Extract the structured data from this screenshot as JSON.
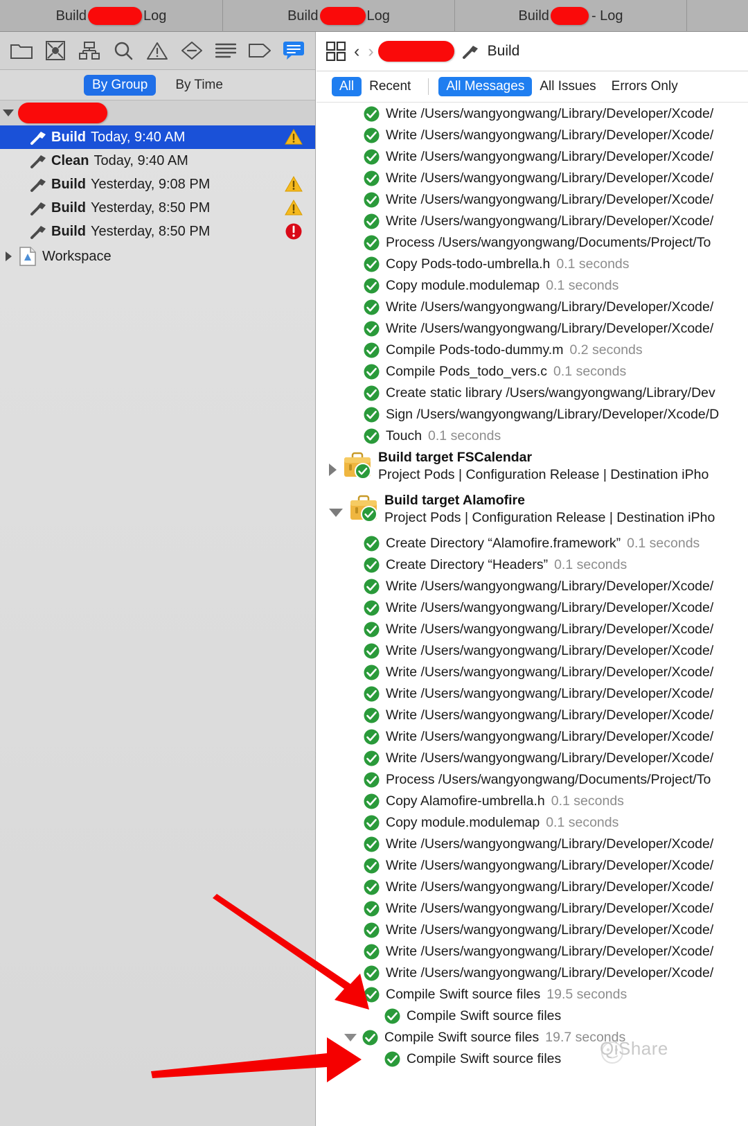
{
  "window": {
    "tabs": [
      {
        "prefix": "Build",
        "suffix": "Log",
        "redacted": true
      },
      {
        "prefix": "Build",
        "suffix": "Log",
        "redacted": true
      },
      {
        "prefix": "Build",
        "suffix": "- Log",
        "redacted": true
      },
      {
        "prefix": "",
        "suffix": "",
        "redacted": false
      }
    ]
  },
  "navigator": {
    "toolbar_icons": [
      "folder-icon",
      "source-control-icon",
      "symbol-hierarchy-icon",
      "search-icon",
      "warning-triangle-icon",
      "breakpoint-icon",
      "report-icon",
      "tag-icon",
      "log-bubble-icon"
    ],
    "scope": {
      "by_group": "By Group",
      "by_time": "By Time",
      "selected": "By Group"
    },
    "group_redacted": true,
    "items": [
      {
        "action": "Build",
        "when": "Today, 9:40 AM",
        "status": "warning",
        "selected": true
      },
      {
        "action": "Clean",
        "when": "Today, 9:40 AM",
        "status": "none",
        "selected": false
      },
      {
        "action": "Build",
        "when": "Yesterday, 9:08 PM",
        "status": "warning",
        "selected": false
      },
      {
        "action": "Build",
        "when": "Yesterday, 8:50 PM",
        "status": "warning",
        "selected": false
      },
      {
        "action": "Build",
        "when": "Yesterday, 8:50 PM",
        "status": "error",
        "selected": false
      }
    ],
    "workspace_label": "Workspace"
  },
  "log": {
    "breadcrumb": {
      "project_redacted": true,
      "action": "Build"
    },
    "filters": {
      "scope": [
        "All",
        "Recent"
      ],
      "scope_selected": "All",
      "level": [
        "All Messages",
        "All Issues",
        "Errors Only"
      ],
      "level_selected": "All Messages"
    },
    "rows": [
      {
        "kind": "task",
        "text": "Write /Users/wangyongwang/Library/Developer/Xcode/",
        "dur": "",
        "indent": 1
      },
      {
        "kind": "task",
        "text": "Write /Users/wangyongwang/Library/Developer/Xcode/",
        "dur": "",
        "indent": 1
      },
      {
        "kind": "task",
        "text": "Write /Users/wangyongwang/Library/Developer/Xcode/",
        "dur": "",
        "indent": 1
      },
      {
        "kind": "task",
        "text": "Write /Users/wangyongwang/Library/Developer/Xcode/",
        "dur": "",
        "indent": 1
      },
      {
        "kind": "task",
        "text": "Write /Users/wangyongwang/Library/Developer/Xcode/",
        "dur": "",
        "indent": 1
      },
      {
        "kind": "task",
        "text": "Write /Users/wangyongwang/Library/Developer/Xcode/",
        "dur": "",
        "indent": 1
      },
      {
        "kind": "task",
        "text": "Process /Users/wangyongwang/Documents/Project/To",
        "dur": "",
        "indent": 1
      },
      {
        "kind": "task",
        "text": "Copy Pods-todo-umbrella.h",
        "dur": "0.1 seconds",
        "indent": 1
      },
      {
        "kind": "task",
        "text": "Copy module.modulemap",
        "dur": "0.1 seconds",
        "indent": 1
      },
      {
        "kind": "task",
        "text": "Write /Users/wangyongwang/Library/Developer/Xcode/",
        "dur": "",
        "indent": 1
      },
      {
        "kind": "task",
        "text": "Write /Users/wangyongwang/Library/Developer/Xcode/",
        "dur": "",
        "indent": 1
      },
      {
        "kind": "task",
        "text": "Compile Pods-todo-dummy.m",
        "dur": "0.2 seconds",
        "indent": 1
      },
      {
        "kind": "task",
        "text": "Compile Pods_todo_vers.c",
        "dur": "0.1 seconds",
        "indent": 1
      },
      {
        "kind": "task",
        "text": "Create static library /Users/wangyongwang/Library/Dev",
        "dur": "",
        "indent": 1
      },
      {
        "kind": "task",
        "text": "Sign /Users/wangyongwang/Library/Developer/Xcode/D",
        "dur": "",
        "indent": 1
      },
      {
        "kind": "task",
        "text": "Touch",
        "dur": "0.1 seconds",
        "indent": 1
      },
      {
        "kind": "target",
        "title": "Build target FSCalendar",
        "sub": "Project Pods | Configuration Release | Destination iPho",
        "expanded": false
      },
      {
        "kind": "target",
        "title": "Build target Alamofire",
        "sub": "Project Pods | Configuration Release | Destination iPho",
        "expanded": true
      },
      {
        "kind": "task",
        "text": "Create Directory “Alamofire.framework”",
        "dur": "0.1 seconds",
        "indent": 1
      },
      {
        "kind": "task",
        "text": "Create Directory “Headers”",
        "dur": "0.1 seconds",
        "indent": 1
      },
      {
        "kind": "task",
        "text": "Write /Users/wangyongwang/Library/Developer/Xcode/",
        "dur": "",
        "indent": 1
      },
      {
        "kind": "task",
        "text": "Write /Users/wangyongwang/Library/Developer/Xcode/",
        "dur": "",
        "indent": 1
      },
      {
        "kind": "task",
        "text": "Write /Users/wangyongwang/Library/Developer/Xcode/",
        "dur": "",
        "indent": 1
      },
      {
        "kind": "task",
        "text": "Write /Users/wangyongwang/Library/Developer/Xcode/",
        "dur": "",
        "indent": 1
      },
      {
        "kind": "task",
        "text": "Write /Users/wangyongwang/Library/Developer/Xcode/",
        "dur": "",
        "indent": 1
      },
      {
        "kind": "task",
        "text": "Write /Users/wangyongwang/Library/Developer/Xcode/",
        "dur": "",
        "indent": 1
      },
      {
        "kind": "task",
        "text": "Write /Users/wangyongwang/Library/Developer/Xcode/",
        "dur": "",
        "indent": 1
      },
      {
        "kind": "task",
        "text": "Write /Users/wangyongwang/Library/Developer/Xcode/",
        "dur": "",
        "indent": 1
      },
      {
        "kind": "task",
        "text": "Write /Users/wangyongwang/Library/Developer/Xcode/",
        "dur": "",
        "indent": 1
      },
      {
        "kind": "task",
        "text": "Process /Users/wangyongwang/Documents/Project/To",
        "dur": "",
        "indent": 1
      },
      {
        "kind": "task",
        "text": "Copy Alamofire-umbrella.h",
        "dur": "0.1 seconds",
        "indent": 1
      },
      {
        "kind": "task",
        "text": "Copy module.modulemap",
        "dur": "0.1 seconds",
        "indent": 1
      },
      {
        "kind": "task",
        "text": "Write /Users/wangyongwang/Library/Developer/Xcode/",
        "dur": "",
        "indent": 1
      },
      {
        "kind": "task",
        "text": "Write /Users/wangyongwang/Library/Developer/Xcode/",
        "dur": "",
        "indent": 1
      },
      {
        "kind": "task",
        "text": "Write /Users/wangyongwang/Library/Developer/Xcode/",
        "dur": "",
        "indent": 1
      },
      {
        "kind": "task",
        "text": "Write /Users/wangyongwang/Library/Developer/Xcode/",
        "dur": "",
        "indent": 1
      },
      {
        "kind": "task",
        "text": "Write /Users/wangyongwang/Library/Developer/Xcode/",
        "dur": "",
        "indent": 1
      },
      {
        "kind": "task",
        "text": "Write /Users/wangyongwang/Library/Developer/Xcode/",
        "dur": "",
        "indent": 1
      },
      {
        "kind": "task",
        "text": "Write /Users/wangyongwang/Library/Developer/Xcode/",
        "dur": "",
        "indent": 1
      },
      {
        "kind": "task",
        "text": "Compile Swift source files",
        "dur": "19.5 seconds",
        "indent": 1
      },
      {
        "kind": "task",
        "text": "Compile Swift source files",
        "dur": "",
        "indent": 2
      },
      {
        "kind": "task",
        "text": "Compile Swift source files",
        "dur": "19.7 seconds",
        "indent": 1,
        "expanded": true
      },
      {
        "kind": "task",
        "text": "Compile Swift source files",
        "dur": "",
        "indent": 2
      }
    ]
  },
  "annotations": {
    "arrows": 2,
    "arrow_color": "#f50000",
    "watermark": "QiShare"
  },
  "colors": {
    "accent_blue": "#1f7ef0",
    "selection_blue": "#1a51d8",
    "success_green": "#2a9a3a",
    "warning_yellow": "#f5b91e",
    "error_red": "#d90a18",
    "redaction_red": "#fa0a0a"
  }
}
